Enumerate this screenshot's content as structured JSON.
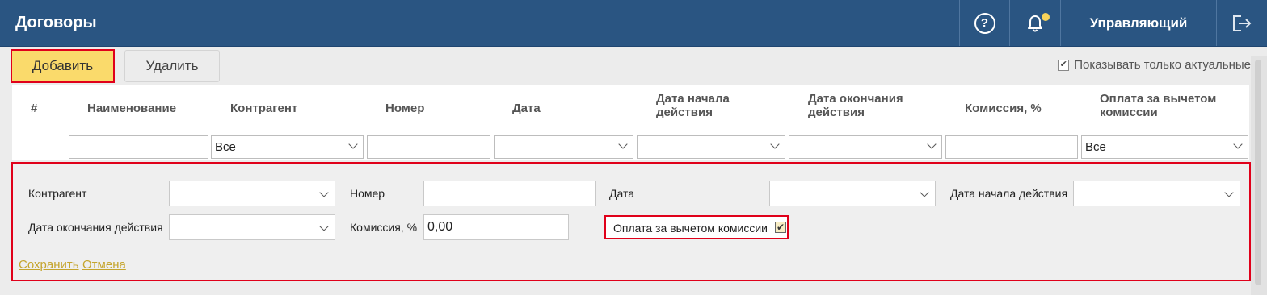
{
  "header": {
    "title": "Договоры",
    "help_glyph": "?",
    "user_name": "Управляющий",
    "icons": [
      "help-icon",
      "bell-icon",
      "logout-icon"
    ]
  },
  "toolbar": {
    "add_label": "Добавить",
    "delete_label": "Удалить",
    "only_actual_label": "Показывать только актуальные",
    "only_actual_checked": true
  },
  "grid": {
    "columns": [
      "#",
      "Наименование",
      "Контрагент",
      "Номер",
      "Дата",
      "Дата начала действия",
      "Дата окончания действия",
      "Комиссия, %",
      "Оплата за вычетом комиссии"
    ],
    "filters": {
      "name": "",
      "counterparty": "Все",
      "number": "",
      "date": "",
      "start_date": "",
      "end_date": "",
      "commission": "",
      "net_payment": "Все"
    }
  },
  "edit_form": {
    "counterparty_label": "Контрагент",
    "counterparty_value": "",
    "number_label": "Номер",
    "number_value": "",
    "date_label": "Дата",
    "date_value": "",
    "start_date_label": "Дата начала действия",
    "start_date_value": "",
    "end_date_label": "Дата окончания действия",
    "end_date_value": "",
    "commission_label": "Комиссия, %",
    "commission_value": "0,00",
    "net_payment_label": "Оплата за вычетом комиссии",
    "net_payment_checked": true,
    "save_label": "Сохранить",
    "cancel_label": "Отмена"
  },
  "colors": {
    "header_bg": "#2a5582",
    "add_button_bg": "#fada6b",
    "highlight_border": "#e0001a",
    "link_color": "#c5a52e",
    "notification_dot": "#f7d35a"
  }
}
